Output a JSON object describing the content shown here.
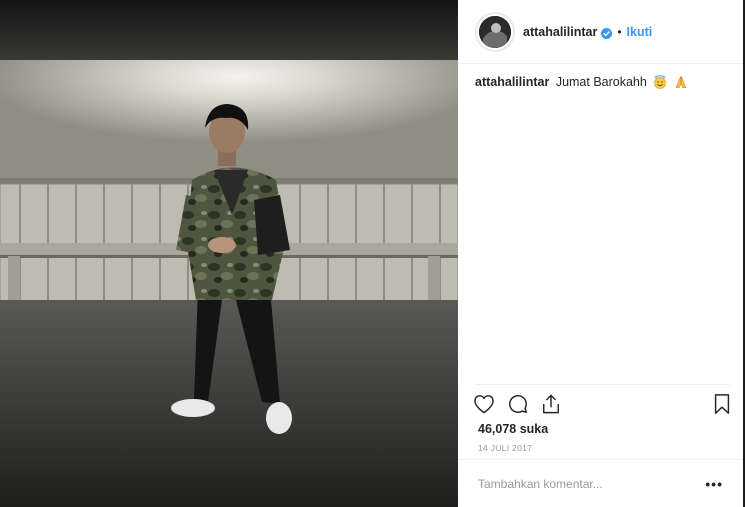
{
  "post": {
    "username": "attahalilintar",
    "separator": "•",
    "follow_label": "Ikuti",
    "caption_user": "attahalilintar",
    "caption_text": "Jumat Barokahh",
    "likes": "46,078 suka",
    "date": "14 JULI 2017"
  },
  "comment": {
    "placeholder": "Tambahkan komentar...",
    "more_label": "•••"
  },
  "icons": {
    "verified": "verified-badge-icon",
    "like": "heart-icon",
    "comment": "speech-bubble-icon",
    "share": "share-icon",
    "save": "bookmark-icon",
    "caption_emojis": [
      "smiling-face-with-halo-icon",
      "folded-hands-icon"
    ]
  },
  "colors": {
    "link_blue": "#3897f0",
    "verified_blue": "#3897f0",
    "text": "#262626",
    "muted": "#999999"
  }
}
